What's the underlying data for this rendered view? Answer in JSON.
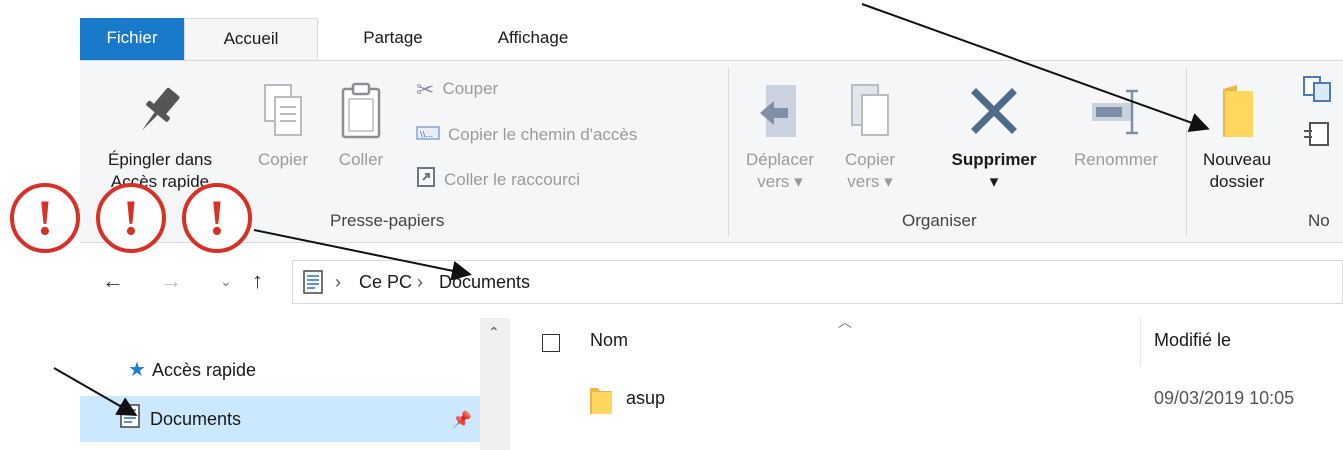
{
  "ribbon": {
    "tabs": [
      {
        "label": "Fichier"
      },
      {
        "label": "Accueil"
      },
      {
        "label": "Partage"
      },
      {
        "label": "Affichage"
      }
    ],
    "clipboard": {
      "pin_label_line1": "Épingler dans",
      "pin_label_line2": "Accès rapide",
      "copy_label": "Copier",
      "paste_label": "Coller",
      "cut_label": "Couper",
      "copy_path_label": "Copier le chemin d'accès",
      "paste_shortcut_label": "Coller le raccourci",
      "group_label": "Presse-papiers"
    },
    "organize": {
      "move_label_line1": "Déplacer",
      "move_label_line2": "vers",
      "copyto_label_line1": "Copier",
      "copyto_label_line2": "vers",
      "delete_label": "Supprimer",
      "rename_label": "Renommer",
      "group_label": "Organiser"
    },
    "new": {
      "new_folder_line1": "Nouveau",
      "new_folder_line2": "dossier",
      "group_label": "No"
    }
  },
  "address": {
    "crumbs": [
      {
        "label": "Ce PC"
      },
      {
        "label": "Documents"
      }
    ]
  },
  "nav_pane": {
    "items": [
      {
        "label": "Accès rapide",
        "icon": "star-icon"
      },
      {
        "label": "Documents",
        "icon": "documents-icon",
        "selected": true,
        "pinned": true
      }
    ]
  },
  "file_list": {
    "columns": [
      {
        "label": "Nom"
      },
      {
        "label": "Modifié le"
      }
    ],
    "rows": [
      {
        "name": "asup",
        "modified": "09/03/2019 10:05",
        "icon": "folder-icon"
      }
    ]
  },
  "annotations": {
    "warning_glyph": "!",
    "warning_count": 3
  },
  "colors": {
    "file_tab": "#1979ca",
    "ribbon_bg": "#f5f6f7",
    "selection": "#cce8ff",
    "warning": "#d93025",
    "folder": "#ffd75e"
  }
}
